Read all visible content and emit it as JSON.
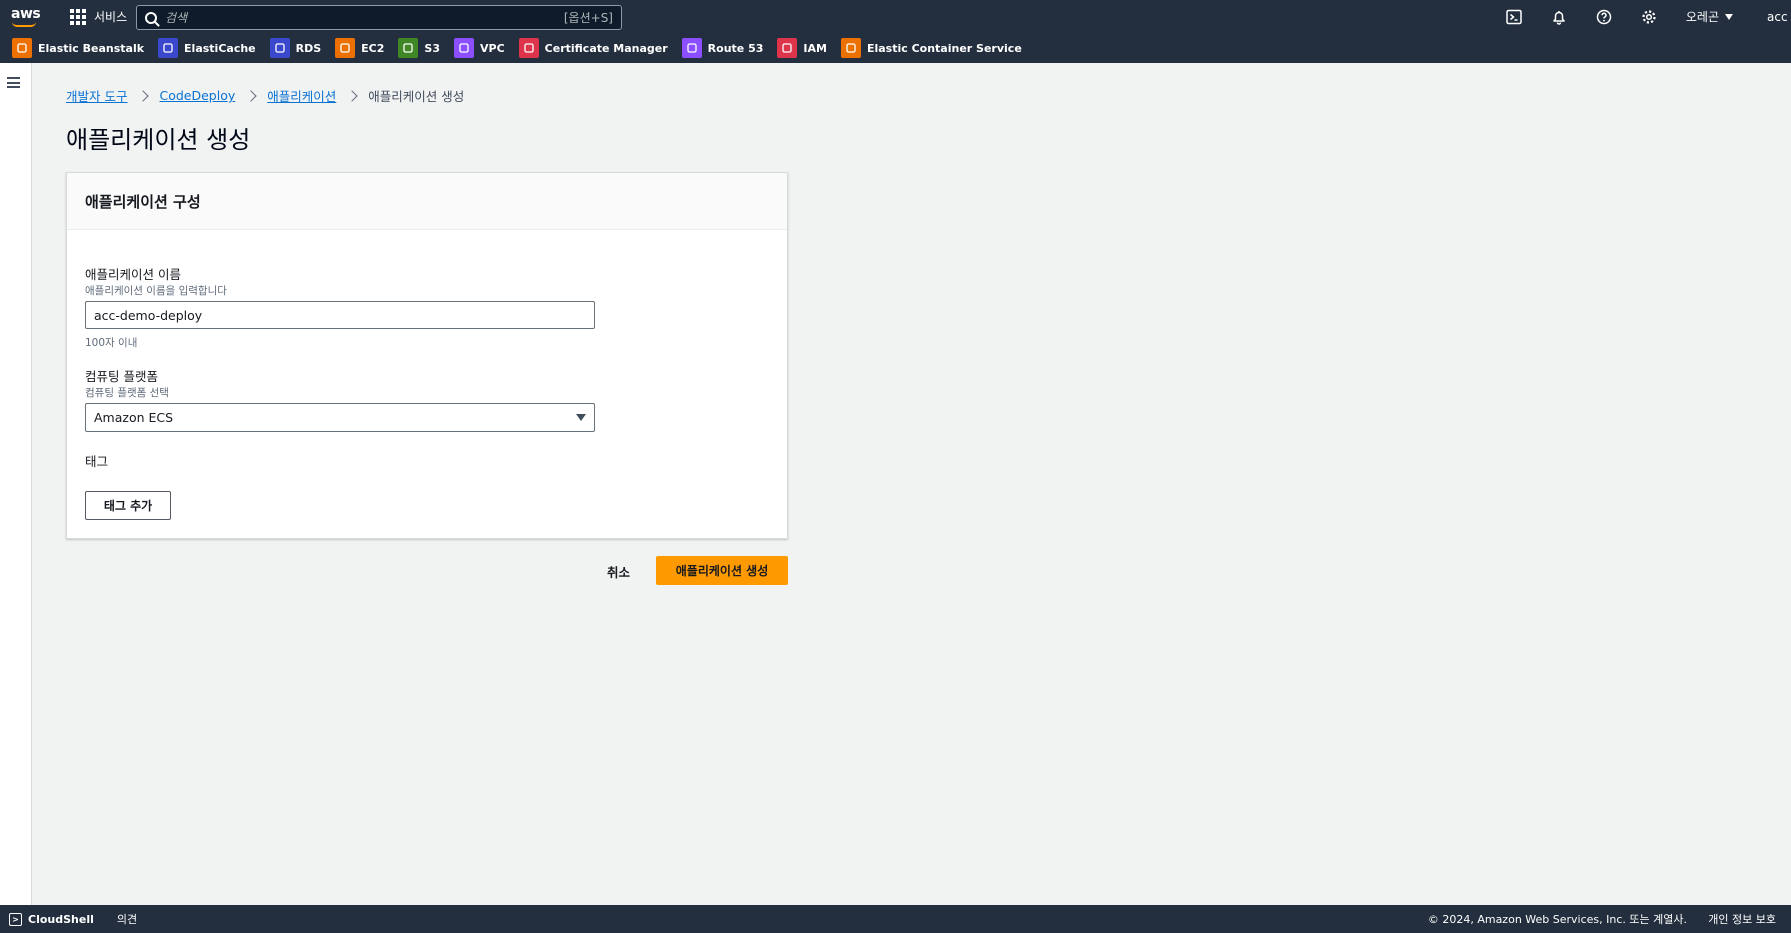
{
  "topnav": {
    "logo": "aws",
    "services_label": "서비스",
    "search_placeholder": "검색",
    "search_shortcut": "[옵션+S]",
    "region_label": "오레곤",
    "account_label": "acc @"
  },
  "favorites": [
    {
      "label": "Elastic Beanstalk",
      "color": "#ed7100",
      "icon": "beanstalk-icon"
    },
    {
      "label": "ElastiCache",
      "color": "#3b48cc",
      "icon": "elasticache-icon"
    },
    {
      "label": "RDS",
      "color": "#3b48cc",
      "icon": "rds-icon"
    },
    {
      "label": "EC2",
      "color": "#ed7100",
      "icon": "ec2-icon"
    },
    {
      "label": "S3",
      "color": "#3f8624",
      "icon": "s3-icon"
    },
    {
      "label": "VPC",
      "color": "#8c4fff",
      "icon": "vpc-icon"
    },
    {
      "label": "Certificate Manager",
      "color": "#dd344c",
      "icon": "certificate-manager-icon"
    },
    {
      "label": "Route 53",
      "color": "#8c4fff",
      "icon": "route53-icon"
    },
    {
      "label": "IAM",
      "color": "#dd344c",
      "icon": "iam-icon"
    },
    {
      "label": "Elastic Container Service",
      "color": "#ed7100",
      "icon": "ecs-icon"
    }
  ],
  "breadcrumb": {
    "items": [
      "개발자 도구",
      "CodeDeploy",
      "애플리케이션"
    ],
    "current": "애플리케이션 생성"
  },
  "page_title": "애플리케이션 생성",
  "panel": {
    "title": "애플리케이션 구성",
    "app_name": {
      "label": "애플리케이션 이름",
      "description": "애플리케이션 이름을 입력합니다",
      "value": "acc-demo-deploy",
      "constraint": "100자 이내"
    },
    "platform": {
      "label": "컴퓨팅 플랫폼",
      "description": "컴퓨팅 플랫폼 선택",
      "selected": "Amazon ECS"
    },
    "tags": {
      "label": "태그",
      "add_button": "태그 추가"
    }
  },
  "actions": {
    "cancel": "취소",
    "create": "애플리케이션 생성"
  },
  "footer": {
    "cloudshell": "CloudShell",
    "feedback": "의견",
    "copyright": "© 2024, Amazon Web Services, Inc. 또는 계열사.",
    "privacy": "개인 정보 보호"
  },
  "colors": {
    "nav_bg": "#232f3e",
    "accent": "#ff9900",
    "link": "#0972d3"
  }
}
